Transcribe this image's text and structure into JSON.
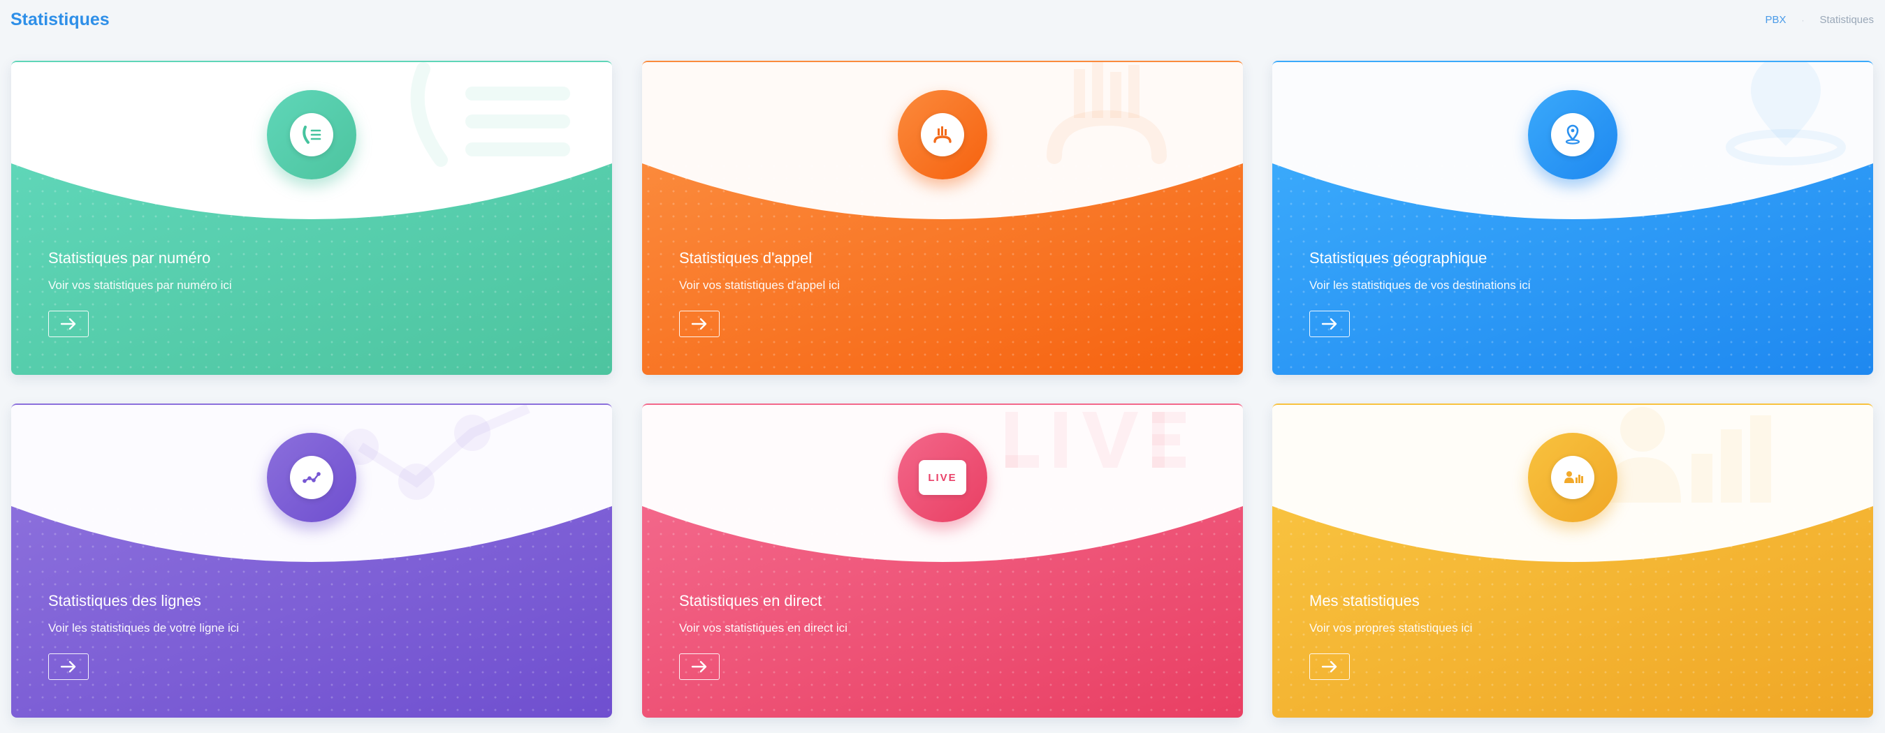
{
  "header": {
    "title": "Statistiques",
    "breadcrumb": {
      "link": "PBX",
      "separator": "·",
      "current": "Statistiques"
    }
  },
  "cards": [
    {
      "title": "Statistiques par numéro",
      "description": "Voir vos statistiques par numéro ici",
      "icon": "phone-list-icon",
      "color_start": "#5fd6b8",
      "color_end": "#4dc49f"
    },
    {
      "title": "Statistiques d'appel",
      "description": "Voir vos statistiques d'appel ici",
      "icon": "phone-chart-icon",
      "color_start": "#fb8a3c",
      "color_end": "#f6620f"
    },
    {
      "title": "Statistiques géographique",
      "description": "Voir les statistiques de vos destinations ici",
      "icon": "location-pin-icon",
      "color_start": "#3aa9fb",
      "color_end": "#1e88f0"
    },
    {
      "title": "Statistiques des lignes",
      "description": "Voir les statistiques de votre ligne ici",
      "icon": "line-chart-icon",
      "color_start": "#8b6fdc",
      "color_end": "#6f4fcf"
    },
    {
      "title": "Statistiques en direct",
      "description": "Voir vos statistiques en direct ici",
      "icon": "live-icon",
      "icon_text": "LIVE",
      "color_start": "#f3678a",
      "color_end": "#e93f63"
    },
    {
      "title": "Mes statistiques",
      "description": "Voir vos propres statistiques ici",
      "icon": "user-stats-icon",
      "color_start": "#f8c23f",
      "color_end": "#f0a726"
    }
  ]
}
